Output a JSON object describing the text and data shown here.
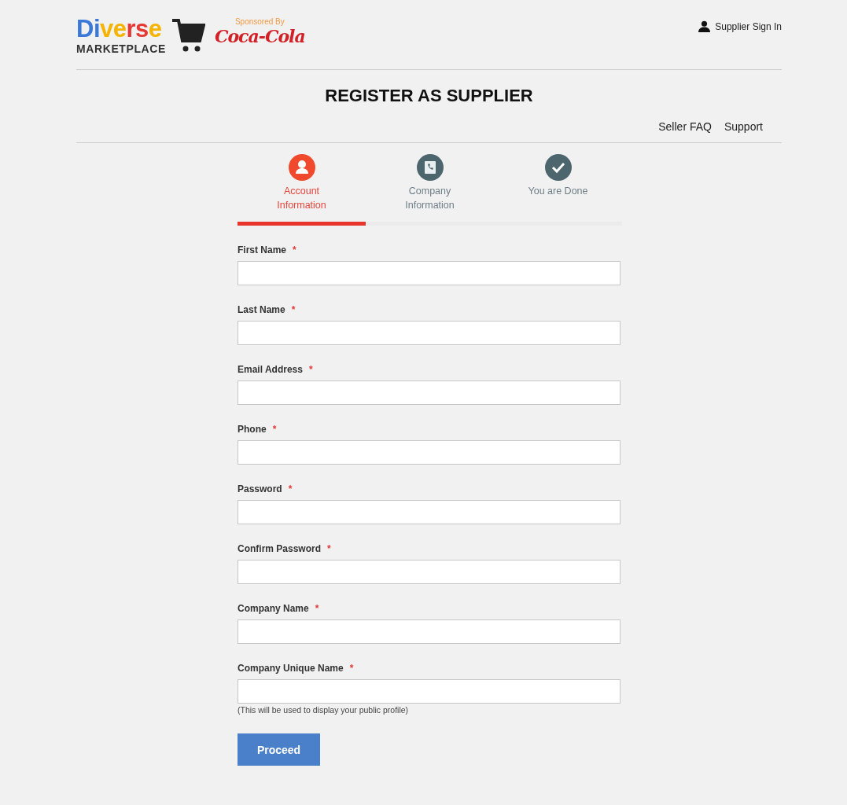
{
  "logo": {
    "letters": [
      {
        "text": "D",
        "color": "#3b78d8"
      },
      {
        "text": "i",
        "color": "#3b78d8"
      },
      {
        "text": "v",
        "color": "#f4b400"
      },
      {
        "text": "e",
        "color": "#f4b400"
      },
      {
        "text": "r",
        "color": "#e53935"
      },
      {
        "text": "s",
        "color": "#e53935"
      },
      {
        "text": "e",
        "color": "#f4b400"
      }
    ],
    "subtitle": "MARKETPLACE",
    "sponsor_label": "Sponsored By",
    "sponsor_name": "Coca-Cola"
  },
  "header": {
    "sign_in": "Supplier Sign In"
  },
  "title": "REGISTER AS SUPPLIER",
  "links": [
    "Seller FAQ",
    "Support"
  ],
  "steps": [
    {
      "label": "Account Information",
      "selected": true
    },
    {
      "label": "Company Information",
      "selected": false
    },
    {
      "label": "You are Done",
      "selected": false
    }
  ],
  "fields": [
    {
      "label": "First Name",
      "required_mark": "*"
    },
    {
      "label": "Last Name",
      "required_mark": "*"
    },
    {
      "label": "Email Address",
      "required_mark": "*"
    },
    {
      "label": "Phone",
      "required_mark": "*"
    },
    {
      "label": "Password",
      "required_mark": "*"
    },
    {
      "label": "Confirm Password",
      "required_mark": "*"
    },
    {
      "label": "Company Name",
      "required_mark": "*"
    },
    {
      "label": "Company Unique Name",
      "required_mark": "*",
      "hint": "(This will be used to display your public profile)"
    }
  ],
  "submit": "Proceed"
}
